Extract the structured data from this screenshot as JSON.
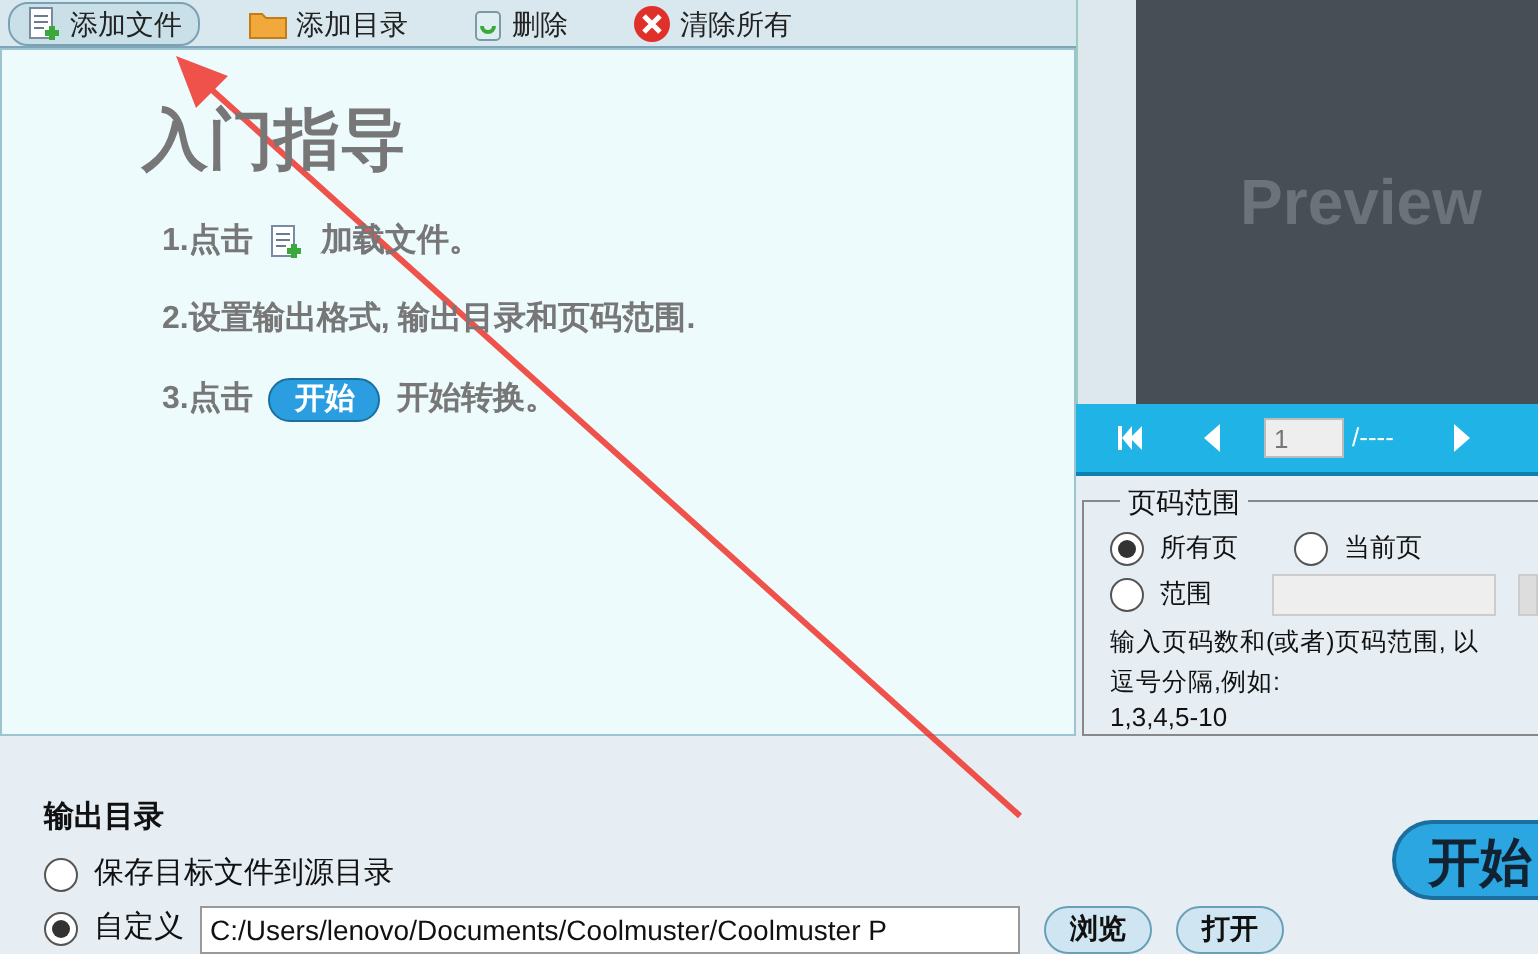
{
  "toolbar": [
    {
      "kind": "add-file",
      "label": "添加文件",
      "selected": true
    },
    {
      "kind": "add-folder",
      "label": "添加目录",
      "selected": false
    },
    {
      "kind": "delete",
      "label": "删除",
      "selected": false
    },
    {
      "kind": "clear",
      "label": "清除所有",
      "selected": false
    }
  ],
  "guide": {
    "title": "入门指导",
    "step1_before": "1.点击",
    "step1_after": "加载文件。",
    "step2": "2.设置输出格式, 输出目录和页码范围.",
    "step3_before": "3.点击",
    "step3_button": "开始",
    "step3_after": "开始转换。"
  },
  "preview": {
    "label": "Preview",
    "page_value": "1",
    "page_total": "/----"
  },
  "page_range": {
    "title": "页码范围",
    "options": [
      {
        "label": "所有页",
        "selected": true
      },
      {
        "label": "当前页",
        "selected": false
      },
      {
        "label": "范围",
        "selected": false
      }
    ],
    "hint": "输入页码数和(或者)页码范围, 以逗号分隔,例如:",
    "example": "1,3,4,5-10"
  },
  "output": {
    "title": "输出目录",
    "options": [
      {
        "label": "保存目标文件到源目录",
        "selected": false
      },
      {
        "label": "自定义",
        "selected": true
      }
    ],
    "path": "C:/Users/lenovo/Documents/Coolmuster/Coolmuster P",
    "browse": "浏览",
    "open": "打开",
    "start": "开始"
  }
}
